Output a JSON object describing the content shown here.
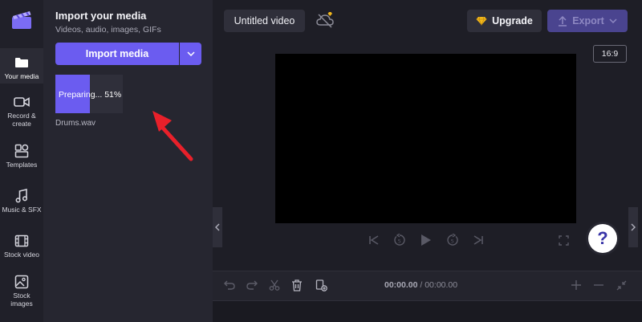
{
  "colors": {
    "accent": "#6b5cf0",
    "panel": "#262630",
    "rail": "#202029",
    "canvas": "#000000",
    "arrow": "#e8202a"
  },
  "sidebar": {
    "items": [
      {
        "label": "Your media",
        "icon": "folder-icon",
        "active": true
      },
      {
        "label": "Record &\ncreate",
        "icon": "video-camera-icon"
      },
      {
        "label": "Templates",
        "icon": "templates-icon"
      },
      {
        "label": "Music & SFX",
        "icon": "music-note-icon"
      },
      {
        "label": "Stock video",
        "icon": "film-icon"
      },
      {
        "label": "Stock\nimages",
        "icon": "image-icon"
      }
    ]
  },
  "media_panel": {
    "title": "Import your media",
    "subtitle": "Videos, audio, images, GIFs",
    "import_label": "Import media",
    "item": {
      "status": "Preparing... 51%",
      "progress": 0.51,
      "filename": "Drums.wav"
    }
  },
  "header": {
    "title": "Untitled video",
    "upgrade_label": "Upgrade",
    "export_label": "Export",
    "aspect_ratio": "16:9"
  },
  "timeline": {
    "current_time": "00:00.00",
    "separator": " / ",
    "total_time": "00:00.00"
  },
  "help_label": "?"
}
